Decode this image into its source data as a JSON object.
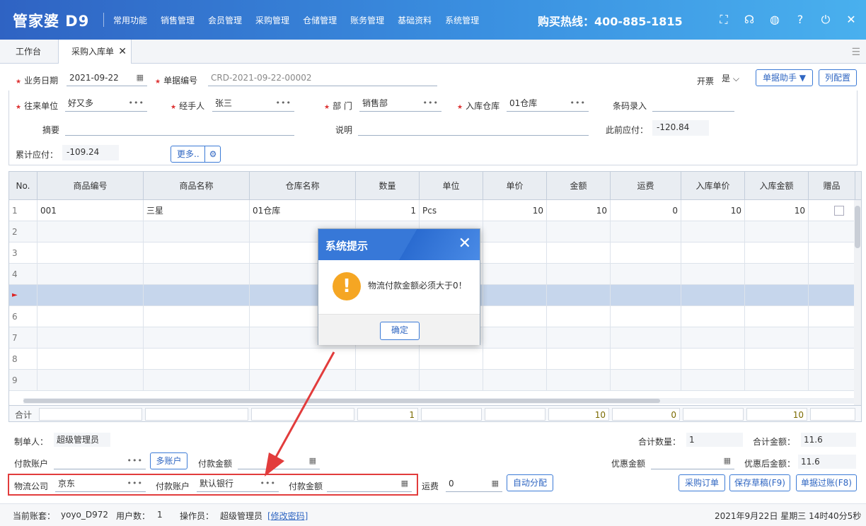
{
  "app": {
    "logo": "管家婆 D9",
    "hotline": "购买热线：400-885-1815"
  },
  "menu": [
    "常用功能",
    "销售管理",
    "会员管理",
    "采购管理",
    "仓储管理",
    "账务管理",
    "基础资料",
    "系统管理"
  ],
  "top_icons": [
    "scan-icon",
    "headset-icon",
    "palette-icon",
    "help-icon",
    "power-icon",
    "close-icon"
  ],
  "tabs": {
    "workbench": "工作台",
    "purchase_in": "采购入库单",
    "close": "✕"
  },
  "form": {
    "biz_date_label": "业务日期",
    "biz_date": "2021-09-22",
    "doc_no_label": "单据编号",
    "doc_no": "CRD-2021-09-22-00002",
    "invoice_label": "开票",
    "invoice_value": "是",
    "doc_helper": "单据助手 ▼",
    "col_config": "列配置",
    "partner_label": "往来单位",
    "partner": "好又多",
    "handler_label": "经手人",
    "handler": "张三",
    "dept_label": "部 门",
    "dept": "销售部",
    "warehouse_label": "入库仓库",
    "warehouse": "01仓库",
    "barcode_label": "条码录入",
    "barcode": "",
    "summary_label": "摘要",
    "summary": "",
    "note_label": "说明",
    "note": "",
    "prev_payable_label": "此前应付：",
    "prev_payable": "-120.84",
    "cum_payable_label": "累计应付：",
    "cum_payable": "-109.24",
    "more_btn": "更多.."
  },
  "grid": {
    "headers": [
      "No.",
      "商品编号",
      "商品名称",
      "仓库名称",
      "数量",
      "单位",
      "单价",
      "金额",
      "运费",
      "入库单价",
      "入库金额",
      "赠品"
    ],
    "rows": [
      {
        "no": "1",
        "code": "001",
        "name": "三星",
        "wh": "01仓库",
        "qty": "1",
        "unit": "Pcs",
        "price": "10",
        "amount": "10",
        "freight": "0",
        "in_price": "10",
        "in_amount": "10"
      },
      {
        "no": "2"
      },
      {
        "no": "3"
      },
      {
        "no": "4"
      },
      {
        "no": "►"
      },
      {
        "no": "6"
      },
      {
        "no": "7"
      },
      {
        "no": "8"
      },
      {
        "no": "9"
      }
    ],
    "sum_label": "合计",
    "sum_qty": "1",
    "sum_amount": "10",
    "sum_freight": "0",
    "sum_in_amount": "10"
  },
  "footer": {
    "maker_label": "制单人：",
    "maker": "超级管理员",
    "total_qty_label": "合计数量：",
    "total_qty": "1",
    "total_amount_label": "合计金额：",
    "total_amount": "11.6",
    "pay_account_label": "付款账户",
    "multi_account": "多账户",
    "pay_amount_label": "付款金额",
    "discount_label": "优惠金额",
    "after_discount_label": "优惠后金额：",
    "after_discount": "11.6",
    "logistics_label": "物流公司",
    "logistics": "京东",
    "pay_account2_label": "付款账户",
    "pay_account2": "默认银行",
    "pay_amount2_label": "付款金额",
    "freight_label": "运费",
    "freight": "0",
    "auto_assign": "自动分配",
    "purchase_order": "采购订单",
    "save_draft": "保存草稿(F9)",
    "post_doc": "单据过账(F8)"
  },
  "statusbar": {
    "account_label": "当前账套：",
    "account": "yoyo_D972",
    "users_label": "用户数：",
    "users": "1",
    "operator_label": "操作员：",
    "operator": "超级管理员",
    "change_pwd": "[修改密码]",
    "datetime": "2021年9月22日 星期三  14时40分5秒"
  },
  "dialog": {
    "title": "系统提示",
    "message": "物流付款金额必须大于0！",
    "ok": "确定",
    "icon": "warning-icon"
  },
  "colors": {
    "accent": "#3778d8",
    "warning": "#f5a623",
    "highlight_box": "#e23c3c",
    "arrow": "#e23c3c"
  }
}
